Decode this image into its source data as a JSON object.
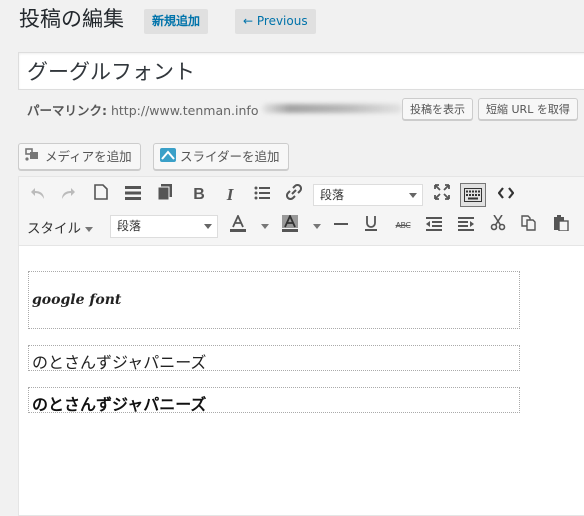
{
  "header": {
    "title": "投稿の編集",
    "new_button": "新規追加",
    "previous_button": "← Previous"
  },
  "post": {
    "title": "グーグルフォント"
  },
  "permalink": {
    "label": "パーマリンク:",
    "url_prefix": "http://www.tenman.info",
    "view_button": "投稿を表示",
    "shortlink_button": "短縮 URL を取得"
  },
  "media_buttons": {
    "add_media": "メディアを追加",
    "add_slider": "スライダーを追加"
  },
  "toolbar": {
    "format_select_row1": "段落",
    "styles_menu": "スタイル",
    "format_select_row2": "段落",
    "strikethrough_label": "ABC",
    "icons_row1": [
      "undo-icon",
      "redo-icon",
      "new-document-icon",
      "read-more-icon",
      "paste-icon",
      "bold-icon",
      "italic-icon",
      "bullet-list-icon",
      "link-icon",
      "fullscreen-icon",
      "keyboard-icon",
      "code-icon"
    ],
    "icons_row2": [
      "font-color-icon",
      "background-color-icon",
      "horizontal-rule-icon",
      "underline-icon",
      "strikethrough-icon",
      "outdent-icon",
      "indent-icon",
      "cut-icon",
      "copy-icon",
      "paste-text-icon"
    ]
  },
  "content": {
    "block1": "google font",
    "block2": "のとさんずジャパニーズ",
    "block3": "のとさんずジャパニーズ"
  }
}
